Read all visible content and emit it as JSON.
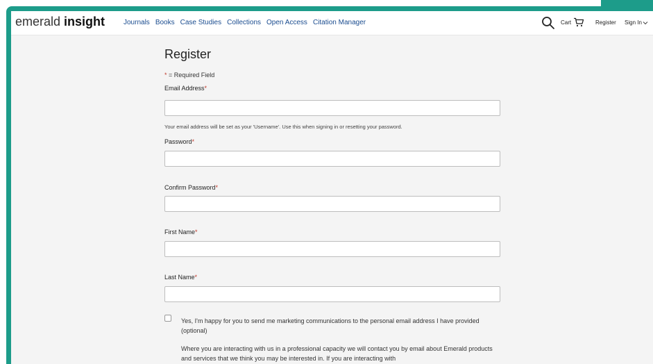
{
  "header": {
    "logo_light": "emerald",
    "logo_bold": "insight",
    "nav": [
      {
        "label": "Journals"
      },
      {
        "label": "Books"
      },
      {
        "label": "Case Studies"
      },
      {
        "label": "Collections"
      },
      {
        "label": "Open Access"
      },
      {
        "label": "Citation Manager"
      }
    ],
    "cart_label": "Cart",
    "register_label": "Register",
    "signin_label": "Sign In"
  },
  "form": {
    "title": "Register",
    "required_star": "*",
    "required_note": " = Required Field",
    "fields": {
      "email": {
        "label": "Email Address",
        "value": "",
        "placeholder": ""
      },
      "password": {
        "label": "Password",
        "value": "",
        "placeholder": ""
      },
      "confirm_password": {
        "label": "Confirm Password",
        "value": "",
        "placeholder": ""
      },
      "first_name": {
        "label": "First Name",
        "value": "",
        "placeholder": ""
      },
      "last_name": {
        "label": "Last Name",
        "value": "",
        "placeholder": ""
      }
    },
    "email_help": "Your email address will be set as your 'Username'. Use this when signing in or resetting your password.",
    "marketing_consent": "Yes, I'm happy for you to send me marketing communications to the personal email address I have provided (optional)",
    "marketing_checked": false,
    "consent_detail": "Where you are interacting with us in a professional capacity we will contact you by email about Emerald products and services that we think you may be interested in. If you are interacting with"
  },
  "colors": {
    "frame": "#1d9c8a",
    "nav_link": "#1a4c8f",
    "required": "#c0392b",
    "page_bg": "#f4f4f4"
  },
  "icons": {
    "search": "search-icon",
    "cart": "cart-icon",
    "signin_dropdown": "chevron-down-icon"
  }
}
